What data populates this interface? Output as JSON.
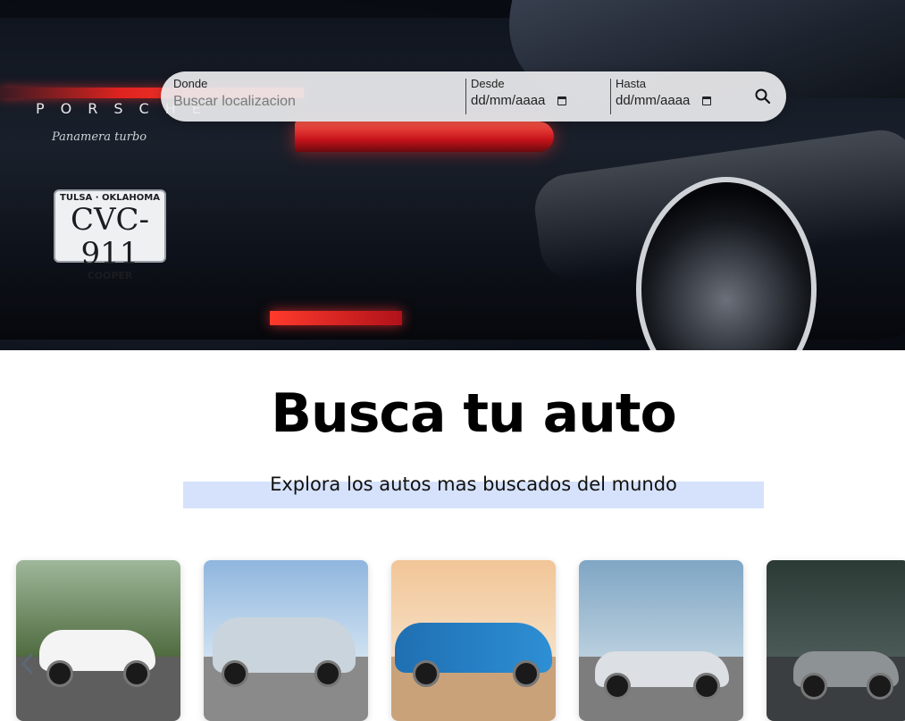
{
  "hero": {
    "brand_text": "PORSCHE",
    "model_text": "Panamera turbo",
    "plate": {
      "top": "TULSA · OKLAHOMA",
      "number": "CVC-911",
      "bottom": "COOPER"
    }
  },
  "search": {
    "where_label": "Donde",
    "where_placeholder": "Buscar localizacion",
    "from_label": "Desde",
    "from_value": "dd/mm/aaaa",
    "to_label": "Hasta",
    "to_value": "dd/mm/aaaa",
    "search_icon": "search-icon"
  },
  "main": {
    "title": "Busca tu auto",
    "subtitle": "Explora los autos mas buscados del mundo"
  },
  "cards": [
    {
      "name": "car-card-1",
      "image": "white-suv"
    },
    {
      "name": "car-card-2",
      "image": "silver-sedan"
    },
    {
      "name": "car-card-3",
      "image": "blue-camaro"
    },
    {
      "name": "car-card-4",
      "image": "silver-coupe"
    },
    {
      "name": "car-card-5",
      "image": "grey-crossover"
    }
  ],
  "colors": {
    "subtitle_highlight": "#d6e2fb",
    "search_bar_bg": "#ececee"
  }
}
